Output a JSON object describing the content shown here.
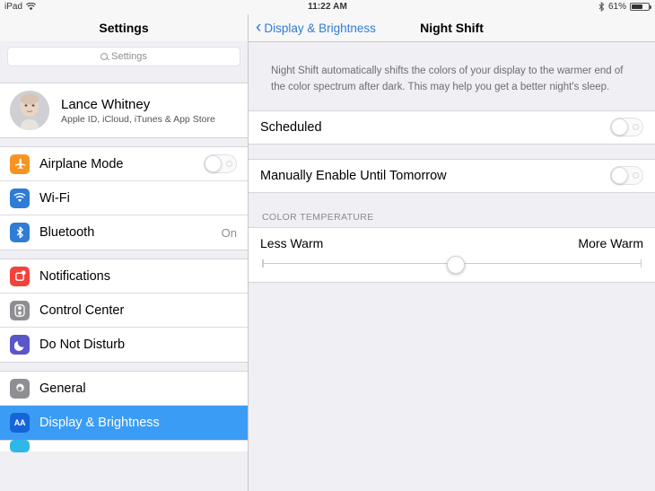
{
  "status_bar": {
    "device": "iPad",
    "wifi_icon": "wifi-icon",
    "time": "11:22 AM",
    "bluetooth_icon": "bluetooth-icon",
    "battery_percent": "61%",
    "battery_level": 61
  },
  "sidebar": {
    "title": "Settings",
    "search": {
      "placeholder": "Settings",
      "value": "",
      "icon": "search-icon"
    },
    "profile": {
      "name": "Lance Whitney",
      "subtitle": "Apple ID, iCloud, iTunes & App Store",
      "avatar": "user-avatar"
    },
    "groups": [
      {
        "items": [
          {
            "label": "Airplane Mode",
            "icon": "airplane-icon",
            "icon_color": "#f79421",
            "glyph": "✈",
            "accessory": "toggle",
            "toggle_on": false,
            "value": ""
          },
          {
            "label": "Wi-Fi",
            "icon": "wifi-icon",
            "icon_color": "#2f7cd6",
            "glyph": "●",
            "accessory": "none",
            "value": ""
          },
          {
            "label": "Bluetooth",
            "icon": "bluetooth-icon",
            "icon_color": "#2f7cd6",
            "glyph": "ᛗ",
            "accessory": "value",
            "value": "On"
          }
        ]
      },
      {
        "items": [
          {
            "label": "Notifications",
            "icon": "notifications-icon",
            "icon_color": "#f3423c",
            "glyph": "▢",
            "accessory": "none",
            "value": ""
          },
          {
            "label": "Control Center",
            "icon": "control-center-icon",
            "icon_color": "#8e8e93",
            "glyph": "⊙",
            "accessory": "none",
            "value": ""
          },
          {
            "label": "Do Not Disturb",
            "icon": "do-not-disturb-icon",
            "icon_color": "#5a57c8",
            "glyph": "☾",
            "accessory": "none",
            "value": ""
          }
        ]
      },
      {
        "items": [
          {
            "label": "General",
            "icon": "gear-icon",
            "icon_color": "#8e8e93",
            "glyph": "⚙",
            "accessory": "none",
            "value": "",
            "selected": false
          },
          {
            "label": "Display & Brightness",
            "icon": "display-brightness-icon",
            "icon_color": "#1565d8",
            "glyph": "AA",
            "accessory": "none",
            "value": "",
            "selected": true
          }
        ]
      }
    ]
  },
  "panel": {
    "back_label": "Display & Brightness",
    "back_icon": "chevron-left-icon",
    "title": "Night Shift",
    "description": "Night Shift automatically shifts the colors of your display to the warmer end of the color spectrum after dark. This may help you get a better night's sleep.",
    "scheduled": {
      "label": "Scheduled",
      "toggle_on": false
    },
    "manual": {
      "label": "Manually Enable Until Tomorrow",
      "toggle_on": false
    },
    "color_temperature": {
      "header": "COLOR TEMPERATURE",
      "min_label": "Less Warm",
      "max_label": "More Warm",
      "value_percent": 51
    }
  }
}
